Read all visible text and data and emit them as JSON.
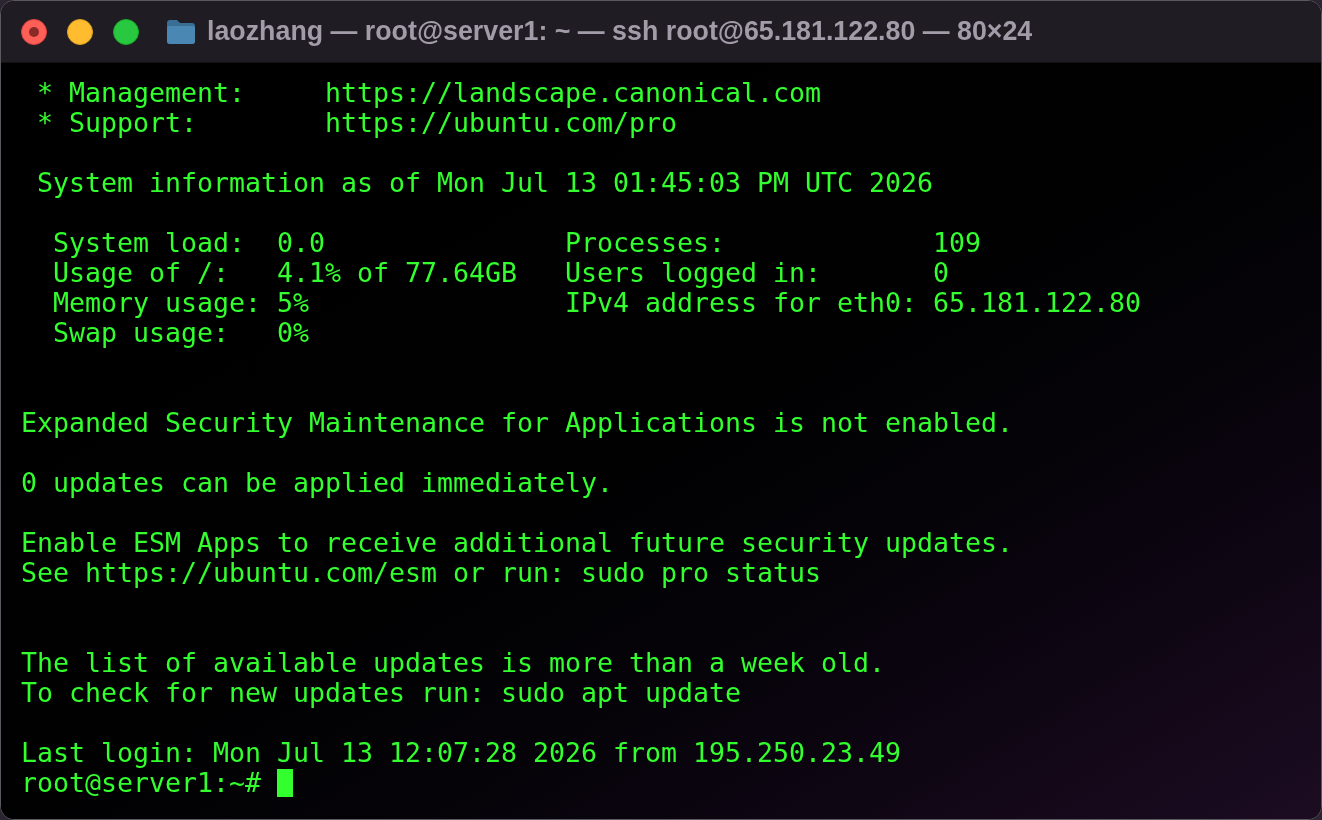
{
  "window": {
    "title": "laozhang — root@server1: ~ — ssh root@65.181.122.80 — 80×24",
    "controls": [
      {
        "kind": "close",
        "modified": true
      },
      {
        "kind": "minimize",
        "modified": false
      },
      {
        "kind": "zoom",
        "modified": false
      }
    ]
  },
  "terminal": {
    "lines": [
      {
        "kind": "text",
        "text": " * Management:     https://landscape.canonical.com"
      },
      {
        "kind": "text",
        "text": " * Support:        https://ubuntu.com/pro"
      },
      {
        "kind": "blank"
      },
      {
        "kind": "text",
        "text": " System information as of Mon Jul 13 01:45:03 PM UTC 2026"
      },
      {
        "kind": "blank"
      },
      {
        "kind": "text",
        "text": "  System load:  0.0               Processes:             109"
      },
      {
        "kind": "text",
        "text": "  Usage of /:   4.1% of 77.64GB   Users logged in:       0"
      },
      {
        "kind": "text",
        "text": "  Memory usage: 5%                IPv4 address for eth0: 65.181.122.80"
      },
      {
        "kind": "text",
        "text": "  Swap usage:   0%"
      },
      {
        "kind": "blank"
      },
      {
        "kind": "blank"
      },
      {
        "kind": "text",
        "text": "Expanded Security Maintenance for Applications is not enabled."
      },
      {
        "kind": "blank"
      },
      {
        "kind": "text",
        "text": "0 updates can be applied immediately."
      },
      {
        "kind": "blank"
      },
      {
        "kind": "text",
        "text": "Enable ESM Apps to receive additional future security updates."
      },
      {
        "kind": "text",
        "text": "See https://ubuntu.com/esm or run: sudo pro status"
      },
      {
        "kind": "blank"
      },
      {
        "kind": "blank"
      },
      {
        "kind": "text",
        "text": "The list of available updates is more than a week old."
      },
      {
        "kind": "text",
        "text": "To check for new updates run: sudo apt update"
      },
      {
        "kind": "blank"
      },
      {
        "kind": "text",
        "text": "Last login: Mon Jul 13 12:07:28 2026 from 195.250.23.49"
      },
      {
        "kind": "prompt",
        "text": "root@server1:~#",
        "cursor": true
      }
    ]
  }
}
